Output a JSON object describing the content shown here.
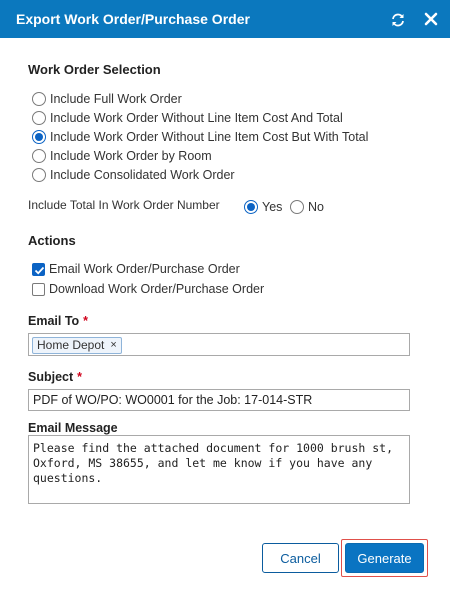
{
  "dialog": {
    "title": "Export Work Order/Purchase Order"
  },
  "work_order_selection": {
    "heading": "Work Order Selection",
    "options": [
      {
        "label": "Include Full Work Order",
        "selected": false
      },
      {
        "label": "Include Work Order Without Line Item Cost And Total",
        "selected": false
      },
      {
        "label": "Include Work Order Without Line Item Cost But With Total",
        "selected": true
      },
      {
        "label": "Include Work Order by Room",
        "selected": false
      },
      {
        "label": "Include Consolidated Work Order",
        "selected": false
      }
    ],
    "include_total_label": "Include Total In Work Order Number",
    "yes_label": "Yes",
    "no_label": "No",
    "include_total_value": "Yes"
  },
  "actions": {
    "heading": "Actions",
    "email_label": "Email Work Order/Purchase Order",
    "email_checked": true,
    "download_label": "Download Work Order/Purchase Order",
    "download_checked": false
  },
  "email_to": {
    "label": "Email To",
    "required_mark": "*",
    "tags": [
      "Home Depot"
    ],
    "tag_remove_glyph": "×"
  },
  "subject": {
    "label": "Subject",
    "required_mark": "*",
    "value": "PDF of WO/PO: WO0001 for the Job: 17-014-STR"
  },
  "email_message": {
    "label": "Email Message",
    "value": "Please find the attached document for 1000 brush st,\nOxford, MS 38655, and let me know if you have any\nquestions."
  },
  "buttons": {
    "cancel": "Cancel",
    "generate": "Generate"
  },
  "colors": {
    "header_bg": "#0b78be",
    "primary": "#0a74c2",
    "required": "#d0021b",
    "highlight_outline": "#e0504a"
  }
}
